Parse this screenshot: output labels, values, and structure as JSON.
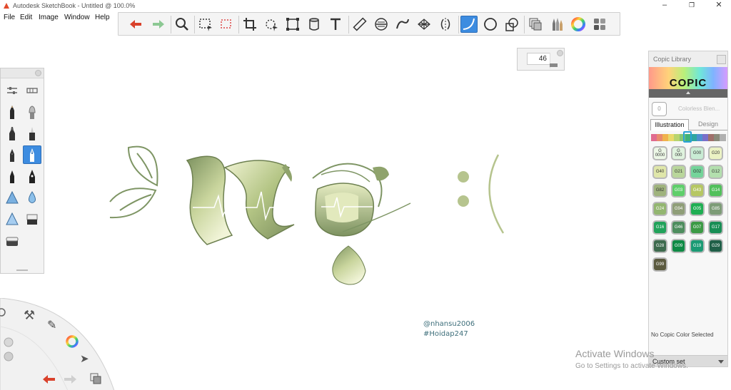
{
  "window": {
    "title": "Autodesk SketchBook - Untitled @ 100.0%",
    "minimize": "–",
    "restore": "❐",
    "close": "✕"
  },
  "menu": [
    "File",
    "Edit",
    "Image",
    "Window",
    "Help"
  ],
  "toolbar": {
    "tools": [
      "undo-icon",
      "redo-icon",
      "zoom-icon",
      "rect-select-icon",
      "lasso-select-icon",
      "crop-icon",
      "transform-icon",
      "distort-icon",
      "fill-icon",
      "text-icon",
      "ruler-icon",
      "ellipse-guide-icon",
      "french-curve-icon",
      "perspective-icon",
      "symmetry-icon",
      "line-icon",
      "ellipse-icon",
      "shape-icon",
      "layers-icon",
      "brush-library-icon",
      "color-wheel-icon",
      "palette-icon"
    ],
    "active_tool": "line-icon",
    "colors": {
      "undo": "#d9412b",
      "redo": "#84c28a",
      "active_bg": "#3d8ce0"
    }
  },
  "brush_size": {
    "value": "46"
  },
  "brush_palette": {
    "brushes": [
      "pencil-icon",
      "airbrush-icon",
      "marker-icon",
      "chisel-marker-icon",
      "ballpoint-icon",
      "fine-pen-icon",
      "inking-pen-icon",
      "calligraphy-pen-icon",
      "smear-icon",
      "blur-icon",
      "triangle-brush-icon",
      "eraser-icon",
      "hard-eraser-icon"
    ],
    "active_brush": "fine-pen-icon"
  },
  "canvas": {
    "credit_line1": "@nhansu2006",
    "credit_line2": "#Hoidap247",
    "art_colors": {
      "dark": "#8a9c6c",
      "light": "#e9efcd",
      "stroke": "#7e9564"
    }
  },
  "lagoon": {
    "items": [
      "gear-icon",
      "tools-icon",
      "brush-icon",
      "color-wheel-icon",
      "pen-icon",
      "select-arrow-icon",
      "layers-icon",
      "undo-icon",
      "redo-icon"
    ]
  },
  "copic": {
    "title": "Copic Library",
    "logo": "COPIC",
    "current_swatch_code": "0",
    "current_swatch_name": "Colorless Blen...",
    "tabs": [
      "Illustration",
      "Design"
    ],
    "selected_tab": "Illustration",
    "strip_colors": [
      "#e06a8e",
      "#e88a6c",
      "#f0b24d",
      "#e9d96a",
      "#b8d46e",
      "#86c774",
      "#3fb27a",
      "#2fa6a0",
      "#4f8fd0",
      "#7a6fc9",
      "#a0706a",
      "#8a8a7a",
      "#b0b0b0"
    ],
    "swatches": [
      {
        "code": "G\n0000",
        "color": "#ecf7e6",
        "text": "#333"
      },
      {
        "code": "G\n000",
        "color": "#dff3de",
        "text": "#333"
      },
      {
        "code": "G00",
        "color": "#c9ecd4",
        "text": "#333"
      },
      {
        "code": "G20",
        "color": "#ebf2c4",
        "text": "#333"
      },
      {
        "code": "G40",
        "color": "#dfe6a9",
        "text": "#333"
      },
      {
        "code": "G21",
        "color": "#b9d69b",
        "text": "#333"
      },
      {
        "code": "G02",
        "color": "#74d49a",
        "text": "#333"
      },
      {
        "code": "G12",
        "color": "#b3dfae",
        "text": "#333"
      },
      {
        "code": "G82",
        "color": "#9fb37d",
        "text": "#333"
      },
      {
        "code": "G03",
        "color": "#5fcf6b",
        "text": "#fff"
      },
      {
        "code": "G43",
        "color": "#b6c763",
        "text": "#fff"
      },
      {
        "code": "G14",
        "color": "#52c05c",
        "text": "#fff"
      },
      {
        "code": "G24",
        "color": "#93b670",
        "text": "#fff"
      },
      {
        "code": "G94",
        "color": "#8f9e78",
        "text": "#fff"
      },
      {
        "code": "G05",
        "color": "#1fae53",
        "text": "#fff"
      },
      {
        "code": "G85",
        "color": "#7d9c77",
        "text": "#fff"
      },
      {
        "code": "G16",
        "color": "#21a25a",
        "text": "#fff"
      },
      {
        "code": "G46",
        "color": "#4e8d5e",
        "text": "#fff"
      },
      {
        "code": "G07",
        "color": "#3c9a45",
        "text": "#fff"
      },
      {
        "code": "G17",
        "color": "#188e55",
        "text": "#fff"
      },
      {
        "code": "G28",
        "color": "#3e6b4e",
        "text": "#fff"
      },
      {
        "code": "G09",
        "color": "#0f8a45",
        "text": "#fff"
      },
      {
        "code": "G19",
        "color": "#1b9a74",
        "text": "#fff"
      },
      {
        "code": "G29",
        "color": "#1f5f48",
        "text": "#fff"
      },
      {
        "code": "G99",
        "color": "#5b5a3f",
        "text": "#fff"
      }
    ],
    "status": "No Copic Color Selected",
    "set_label": "Custom set"
  },
  "watermark": {
    "line1": "Activate Windows",
    "line2": "Go to Settings to activate Windows."
  }
}
